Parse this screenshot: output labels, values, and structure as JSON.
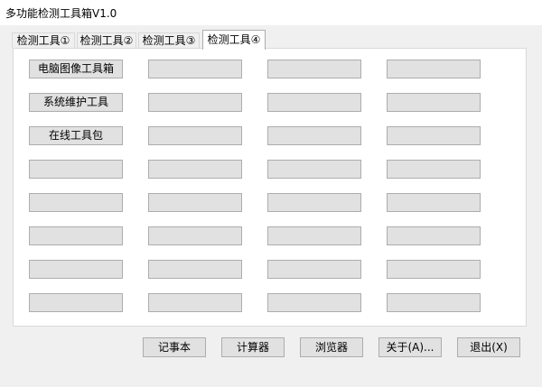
{
  "window": {
    "title": "多功能检测工具箱V1.0"
  },
  "tabs": [
    {
      "label": "检测工具①",
      "active": false
    },
    {
      "label": "检测工具②",
      "active": false
    },
    {
      "label": "检测工具③",
      "active": false
    },
    {
      "label": "检测工具④",
      "active": true
    }
  ],
  "tools": {
    "col1": [
      "电脑图像工具箱",
      "系统维护工具",
      "在线工具包",
      "",
      "",
      "",
      "",
      ""
    ]
  },
  "bottom_buttons": {
    "notepad": "记事本",
    "calculator": "计算器",
    "browser": "浏览器",
    "about": "关于(A)...",
    "exit": "退出(X)"
  },
  "colors": {
    "button_face": "#e1e1e1",
    "button_border": "#adadad",
    "panel_bg": "#ffffff",
    "window_bg": "#f0f0f0"
  }
}
